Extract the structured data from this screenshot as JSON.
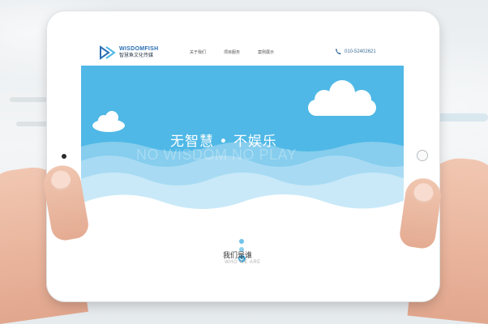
{
  "site": {
    "brand_en": "WISDOMFISH",
    "brand_cn": "智慧鱼文化传媒",
    "nav": [
      {
        "label": "关于我们"
      },
      {
        "label": "项目服务"
      },
      {
        "label": "案例展示"
      }
    ],
    "phone": "010-52402621"
  },
  "hero": {
    "slogan_cn": "无智慧 • 不娱乐",
    "slogan_en": "NO WISDOM NO PLAY"
  },
  "section": {
    "title": "我们是谁",
    "subtitle": "WHO WE ARE"
  },
  "colors": {
    "sky": "#4fb8e6",
    "wave_light": "#bfe4f6",
    "accent": "#3aa5da",
    "brand": "#2a6fb5"
  },
  "icons": {
    "logo": "play-arrow-logo-icon",
    "phone": "phone-icon",
    "scroll": "chevron-down-icon"
  }
}
